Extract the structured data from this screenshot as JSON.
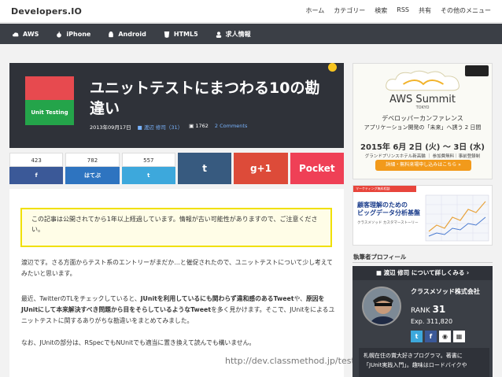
{
  "header": {
    "logo": "Developers.IO",
    "nav": [
      "ホーム",
      "カテゴリー",
      "検索",
      "RSS",
      "共有",
      "その他のメニュー"
    ]
  },
  "categories": [
    {
      "label": "AWS",
      "icon": "cloud-icon"
    },
    {
      "label": "iPhone",
      "icon": "apple-icon"
    },
    {
      "label": "Android",
      "icon": "android-icon"
    },
    {
      "label": "HTML5",
      "icon": "html5-icon"
    },
    {
      "label": "求人情報",
      "icon": "user-icon"
    }
  ],
  "article": {
    "thumb_label": "Unit Testing",
    "title": "ユニットテストにまつわる10の勘違い",
    "date": "2013年09月17日",
    "author": "渡辺 修司（31）",
    "views": "1762",
    "comments": "2 Comments"
  },
  "social": {
    "facebook": {
      "count": "423",
      "label": "f"
    },
    "hatena": {
      "count": "782",
      "label": "はてぶ"
    },
    "twitter": {
      "count": "557",
      "label": "t"
    },
    "tumblr": {
      "label": "t"
    },
    "gplus": {
      "label": "g+1"
    },
    "pocket": {
      "label": "Pocket"
    }
  },
  "body": {
    "notice": "この記事は公開されてから1年以上経過しています。情報が古い可能性がありますので、ご注意ください。",
    "p1": "渡辺です。さる方面からテスト系のエントリーがまだか…と催促されたので、ユニットテストについて少し考えてみたいと思います。",
    "p2a": "最近、TwitterのTLをチェックしていると、",
    "p2b": "JUnitを利用しているにも関わらず違和感のあるTweet",
    "p2c": "や、",
    "p2d": "原因をJUnitにして本来解決すべき問題から目をそらしているようなTweet",
    "p2e": "を多く見かけます。そこで、JUnitをによるユニットテストに関するありがちな勘違いをまとめてみました。",
    "p3": "なお、JUnitの部分は、RSpecでもNUnitでも適当に置き換えて読んでも構いません。",
    "url": "http://dev.classmethod.jp/testi"
  },
  "ads": {
    "aws_title": "AWS Summit",
    "aws_tokyo": "TOKYO",
    "aws_sub": "デベロッパーカンファレンス",
    "aws_sub2": "アプリケーション開発の「未来」へ誘う 2 日間",
    "aws_date": "2015年 6月 2日 (火) 〜 3日 (水)",
    "aws_venue": "グランドプリンスホテル新高輪 ｜ 参加費無料｜事前登録制",
    "aws_button": "詳細・無料来場申し込みはこちら »",
    "ad2_ribbon": "マーケティング無料相談",
    "ad2_head1": "顧客理解のための",
    "ad2_head2": "ビッグデータ分析基盤",
    "ad2_sub": "クラスメソッド カスタマーストーリー"
  },
  "sidebar": {
    "heading": "執筆者プロフィール",
    "profile_button": "渡辺 修司 について詳しくみる ›",
    "company": "クラスメソッド株式会社",
    "rank_label": "RANK",
    "rank_value": "31",
    "exp": "Exp. 311,820",
    "icons": [
      "t",
      "f",
      "gh",
      "doc"
    ],
    "bio1": "札幌在住の賞大好きプログラマ。著書に",
    "bio2": "「JUnit実践入門」。趣味はロードバイクや"
  },
  "colors": {
    "dark": "#2f3239",
    "accent_blue": "#79b4ff",
    "notice_border": "#f0e000",
    "aws_orange": "#f29a1b"
  }
}
